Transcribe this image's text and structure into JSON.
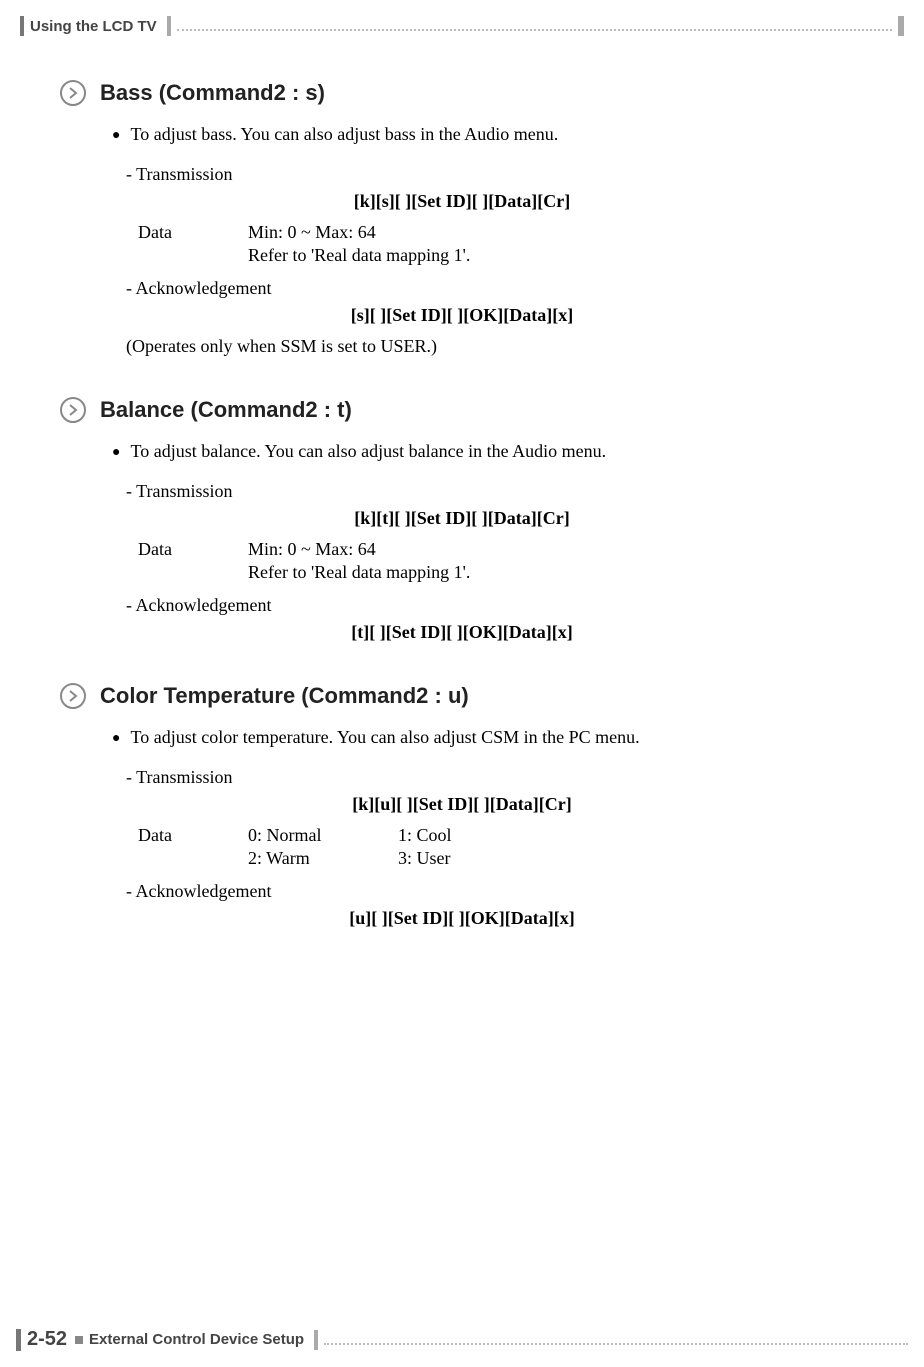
{
  "header": {
    "title": "Using the LCD TV"
  },
  "sections": [
    {
      "title": "Bass (Command2 : s)",
      "desc": "To adjust bass. You can also adjust bass in the Audio menu.",
      "trans_label": "- Transmission",
      "trans_cmd": "[k][s][ ][Set ID][ ][Data][Cr]",
      "data_label": "Data",
      "data_lines": [
        [
          "Min: 0 ~ Max: 64",
          ""
        ],
        [
          "Refer to 'Real data mapping 1'.",
          ""
        ]
      ],
      "ack_label": "- Acknowledgement",
      "ack_cmd": "[s][ ][Set ID][ ][OK][Data][x]",
      "note": "(Operates only when SSM is set to USER.)"
    },
    {
      "title": "Balance (Command2 : t)",
      "desc": "To adjust balance. You can also adjust balance in the Audio menu.",
      "trans_label": "- Transmission",
      "trans_cmd": "[k][t][ ][Set ID][ ][Data][Cr]",
      "data_label": "Data",
      "data_lines": [
        [
          "Min: 0 ~ Max: 64",
          ""
        ],
        [
          "Refer to 'Real data mapping 1'.",
          ""
        ]
      ],
      "ack_label": "- Acknowledgement",
      "ack_cmd": "[t][ ][Set ID][ ][OK][Data][x]",
      "note": ""
    },
    {
      "title": "Color Temperature (Command2 : u)",
      "desc": "To adjust color temperature. You can also adjust CSM in the PC menu.",
      "trans_label": "- Transmission",
      "trans_cmd": "[k][u][ ][Set ID][ ][Data][Cr]",
      "data_label": "Data",
      "data_lines": [
        [
          "0: Normal",
          "1: Cool"
        ],
        [
          "2: Warm",
          "3: User"
        ]
      ],
      "ack_label": "- Acknowledgement",
      "ack_cmd": "[u][ ][Set ID][ ][OK][Data][x]",
      "note": ""
    }
  ],
  "footer": {
    "page": "2-52",
    "title": "External Control Device Setup"
  }
}
